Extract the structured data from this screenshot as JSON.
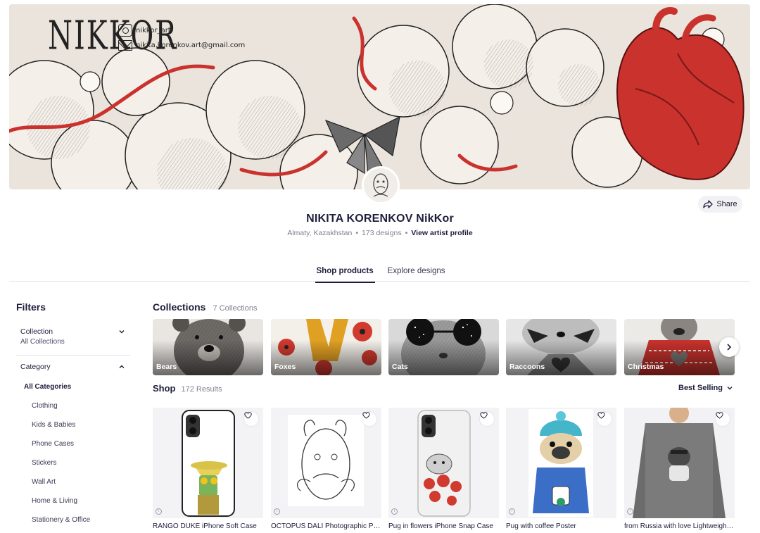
{
  "banner": {
    "signature": "NIKKOR",
    "instagram": "nikkor_art",
    "email": "nikita.korenkov.art@gmail.com"
  },
  "profile": {
    "name": "NIKITA KORENKOV NikKor",
    "location": "Almaty, Kazakhstan",
    "designs": "173 designs",
    "artist_link": "View artist profile",
    "share_label": "Share"
  },
  "tabs": [
    {
      "label": "Shop products",
      "active": true
    },
    {
      "label": "Explore designs",
      "active": false
    }
  ],
  "filters": {
    "title": "Filters",
    "collection": {
      "label": "Collection",
      "value": "All Collections"
    },
    "category": {
      "label": "Category",
      "items": [
        "All Categories",
        "Clothing",
        "Kids & Babies",
        "Phone Cases",
        "Stickers",
        "Wall Art",
        "Home & Living",
        "Stationery & Office"
      ]
    }
  },
  "collections": {
    "title": "Collections",
    "count": "7 Collections",
    "items": [
      {
        "label": "Bears"
      },
      {
        "label": "Foxes"
      },
      {
        "label": "Cats"
      },
      {
        "label": "Raccoons"
      },
      {
        "label": "Christmas"
      }
    ]
  },
  "shop": {
    "title": "Shop",
    "count": "172 Results",
    "sort_label": "Best Selling",
    "products": [
      {
        "title": "RANGO DUKE iPhone Soft Case"
      },
      {
        "title": "OCTOPUS DALI Photographic Print"
      },
      {
        "title": "Pug in flowers iPhone Snap Case"
      },
      {
        "title": "Pug with coffee Poster"
      },
      {
        "title": "from Russia with love Lightweight Sweatshirt"
      }
    ]
  },
  "colors": {
    "text_primary": "#1e1e3c",
    "banner_background": "#ebe4dc",
    "heart_red": "#c9322d"
  }
}
